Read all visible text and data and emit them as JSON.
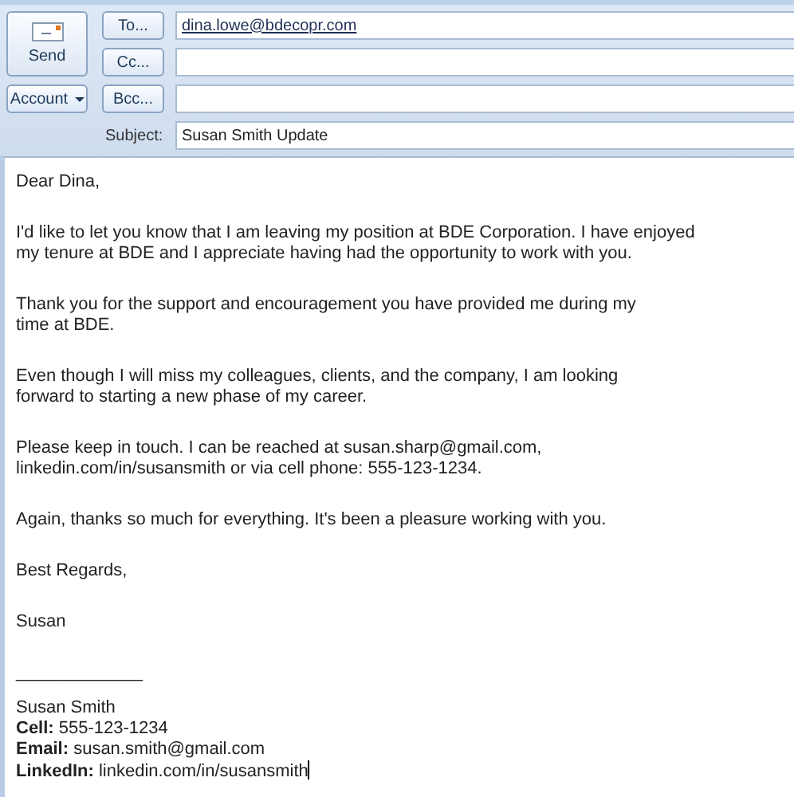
{
  "header": {
    "send": "Send",
    "account": "Account",
    "recipients": [
      {
        "label": "To...",
        "value": "dina.lowe@bdecopr.com"
      },
      {
        "label": "Cc..."
      },
      {
        "label": "Bcc..."
      }
    ],
    "subject_label": "Subject:",
    "subject": "Susan Smith Update"
  },
  "body": {
    "paragraphs": [
      [
        "Dear Dina,"
      ],
      [
        "I'd like to let you know that I am leaving my position at BDE Corporation.  I have enjoyed",
        "my tenure  at BDE and I appreciate having had the opportunity to work with you."
      ],
      [
        "Thank you for the support  and encouragement you have provided me during my",
        "time at BDE."
      ],
      [
        "Even though I will miss my colleagues, clients, and the company,  I am looking",
        "forward to starting a new phase of my career."
      ],
      [
        "Please keep in touch. I can be reached at susan.sharp@gmail.com,",
        "linkedin.com/in/susansmith or via cell phone: 555-123-1234."
      ],
      [
        "Again, thanks so much for everything. It's been a pleasure working with you."
      ],
      [
        "Best Regards,"
      ],
      [
        "Susan"
      ]
    ],
    "rule": "_____________",
    "signature": [
      "Susan Smith",
      "**Cell:** 555-123-1234",
      "**Email:** susan.smith@gmail.com",
      "**LinkedIn:** linkedin.com/in/susansmith"
    ]
  }
}
